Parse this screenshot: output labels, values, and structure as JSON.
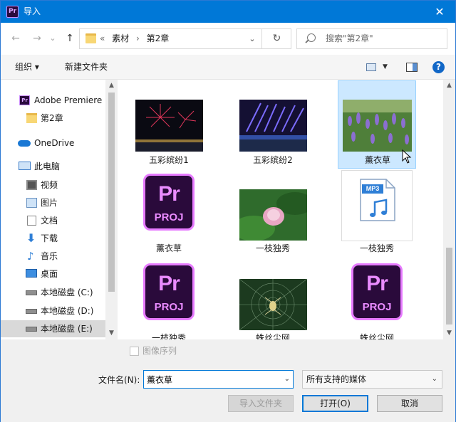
{
  "window": {
    "title": "导入",
    "app_icon_text": "Pr",
    "close_glyph": "✕"
  },
  "nav": {
    "back": "←",
    "forward": "→",
    "history": "⌄",
    "up": "↑",
    "breadcrumb": {
      "overflow": "«",
      "items": [
        "素材",
        "第2章"
      ],
      "separator": "›"
    },
    "dropdown": "⌄",
    "refresh": "↻"
  },
  "search": {
    "placeholder": "搜索\"第2章\""
  },
  "toolbar": {
    "organize": "组织 ▾",
    "new_folder": "新建文件夹",
    "view_dd": "▼",
    "help": "?"
  },
  "sidebar": {
    "items": [
      {
        "label": "Adobe Premiere",
        "icon": "premiere-icon"
      },
      {
        "label": "第2章",
        "icon": "folder-icon"
      },
      {
        "label": "OneDrive",
        "icon": "onedrive-icon"
      },
      {
        "label": "此电脑",
        "icon": "computer-icon"
      },
      {
        "label": "视频",
        "icon": "video-icon"
      },
      {
        "label": "图片",
        "icon": "pictures-icon"
      },
      {
        "label": "文档",
        "icon": "documents-icon"
      },
      {
        "label": "下载",
        "icon": "download-icon"
      },
      {
        "label": "音乐",
        "icon": "music-icon"
      },
      {
        "label": "桌面",
        "icon": "desktop-icon"
      },
      {
        "label": "本地磁盘 (C:)",
        "icon": "drive-c-icon"
      },
      {
        "label": "本地磁盘 (D:)",
        "icon": "drive-icon"
      },
      {
        "label": "本地磁盘 (E:)",
        "icon": "drive-icon"
      }
    ]
  },
  "files": [
    {
      "name": "五彩缤纷1",
      "kind": "fireworks-thumbnail"
    },
    {
      "name": "五彩缤纷2",
      "kind": "fireworks-blue-thumbnail"
    },
    {
      "name": "薰衣草",
      "kind": "lavender-thumbnail",
      "selected": true
    },
    {
      "name": "薰衣草",
      "kind": "premiere-project-icon",
      "icon_top": "Pr",
      "icon_bottom": "PROJ"
    },
    {
      "name": "一枝独秀",
      "kind": "lotus-thumbnail"
    },
    {
      "name": "一枝独秀",
      "kind": "mp3-file-icon",
      "icon_label": "MP3"
    },
    {
      "name": "一枝独秀",
      "kind": "premiere-project-icon",
      "icon_top": "Pr",
      "icon_bottom": "PROJ"
    },
    {
      "name": "蛛丝尘网",
      "kind": "spider-thumbnail"
    },
    {
      "name": "蛛丝尘网",
      "kind": "premiere-project-icon",
      "icon_top": "Pr",
      "icon_bottom": "PROJ"
    }
  ],
  "bottom": {
    "image_sequence_label": "图像序列",
    "filename_label": "文件名(N):",
    "filename_value": "薰衣草",
    "filetype_value": "所有支持的媒体",
    "import_folder_btn": "导入文件夹",
    "open_btn": "打开(O)",
    "cancel_btn": "取消"
  },
  "colors": {
    "titlebar": "#0078d7",
    "selection": "#cce8ff",
    "premiere_purple": "#ea8cff"
  }
}
